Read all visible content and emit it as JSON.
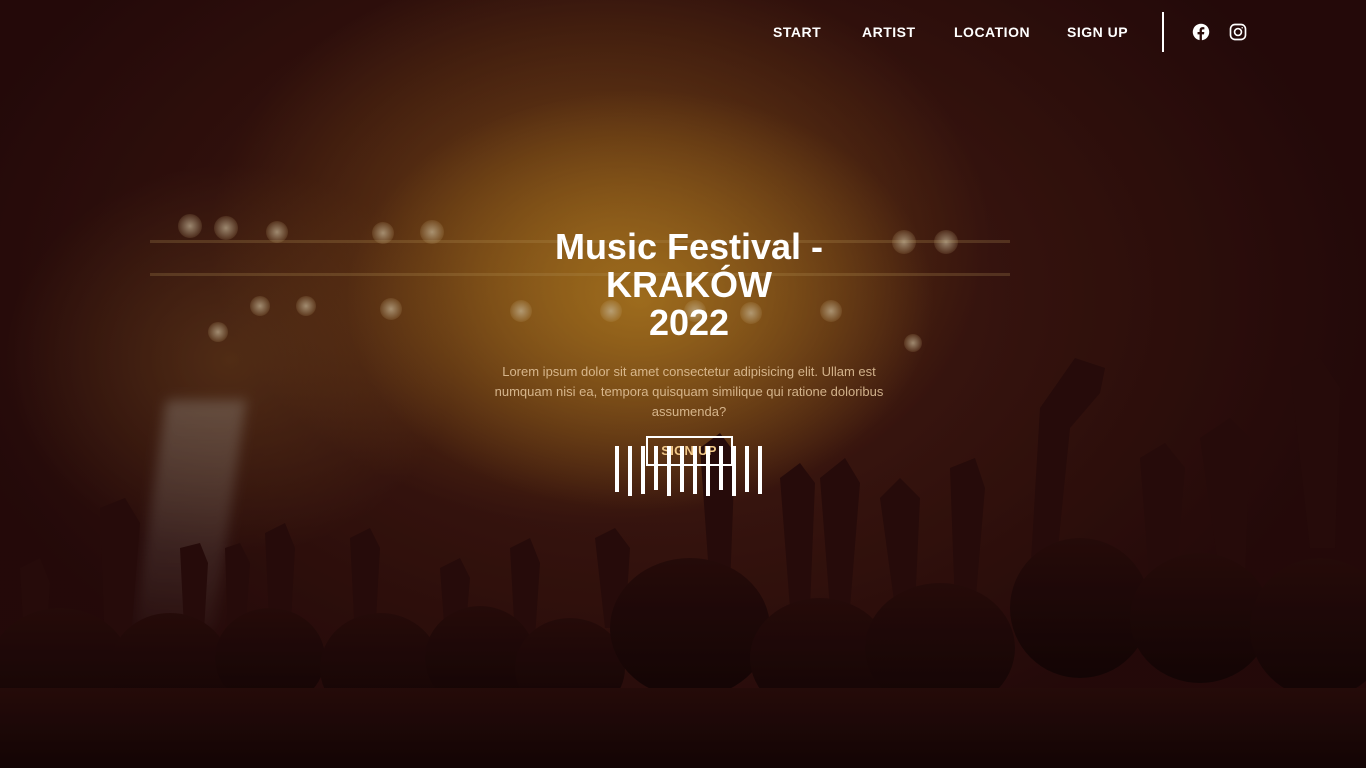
{
  "nav": {
    "links": [
      {
        "label": "START"
      },
      {
        "label": "ARTIST"
      },
      {
        "label": "LOCATION"
      },
      {
        "label": "SIGN UP"
      }
    ],
    "social": [
      {
        "icon": "facebook-icon"
      },
      {
        "icon": "instagram-icon"
      }
    ]
  },
  "hero": {
    "title_line1": "Music Festival - KRAKÓW",
    "title_line2": "2022",
    "text": "Lorem ipsum dolor sit amet consectetur adipisicing elit. Ullam est numquam nisi ea, tempora quisquam similique qui ratione doloribus assumenda?",
    "button_label": "SIGN UP"
  },
  "colors": {
    "text": "#ffffff",
    "button_text": "#f2c98a",
    "body_text": "#e6c8a0"
  }
}
